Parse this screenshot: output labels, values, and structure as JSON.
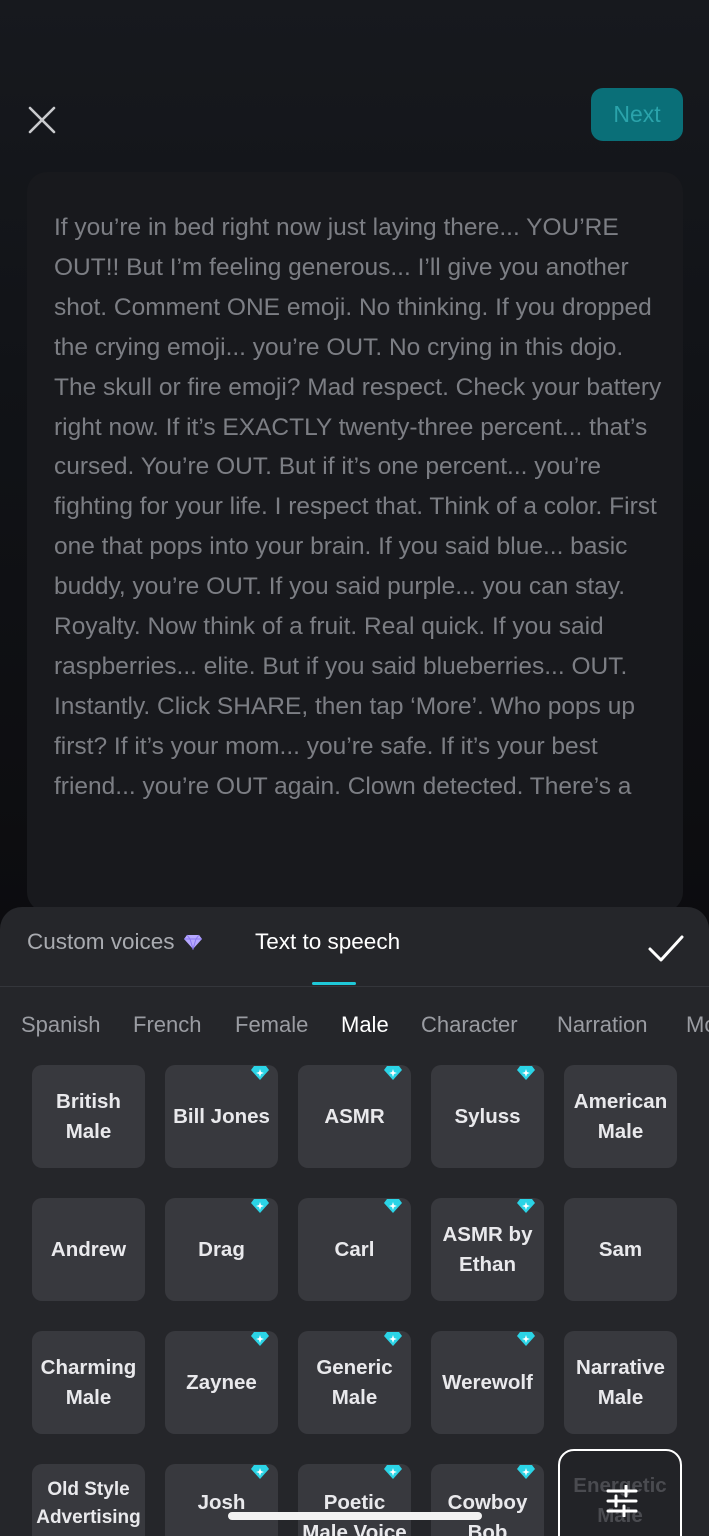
{
  "header": {
    "close_icon": "close-icon",
    "next_label": "Next"
  },
  "script": {
    "text": "If you’re in bed right now just laying there... YOU’RE OUT!! But I’m feeling generous... I’ll give you another shot. Comment ONE emoji. No thinking. If you dropped the crying emoji... you’re OUT. No crying in this dojo. The skull or fire emoji? Mad respect. Check your battery right now. If it’s EXACTLY twenty-three percent... that’s cursed. You’re OUT. But if it’s one percent... you’re fighting for your life. I respect that. Think of a color. First one that pops into your brain. If you said blue... basic buddy, you’re OUT. If you said purple... you can stay. Royalty. Now think of a fruit. Real quick. If you said raspberries... elite. But if you said blueberries... OUT. Instantly. Click SHARE, then tap ‘More’. Who pops up first? If it’s your mom... you’re safe. If it’s your best friend... you’re OUT again. Clown detected. There’s a"
  },
  "panel": {
    "tabs": [
      {
        "label": "Custom voices",
        "icon": "diamond-icon"
      },
      {
        "label": "Text to speech",
        "active": true
      }
    ],
    "confirm_icon": "checkmark-icon",
    "categories": [
      "Spanish",
      "French",
      "Female",
      "Male",
      "Character",
      "Narration",
      "Mo"
    ],
    "active_category": "Male",
    "voices": [
      {
        "name": "British Male",
        "premium": false
      },
      {
        "name": "Bill Jones",
        "premium": true
      },
      {
        "name": "ASMR",
        "premium": true
      },
      {
        "name": "Syluss",
        "premium": true
      },
      {
        "name": "American Male",
        "premium": false
      },
      {
        "name": "Andrew",
        "premium": false
      },
      {
        "name": "Drag",
        "premium": true
      },
      {
        "name": "Carl",
        "premium": true
      },
      {
        "name": "ASMR by Ethan",
        "premium": true
      },
      {
        "name": "Sam",
        "premium": false
      },
      {
        "name": "Charming Male",
        "premium": false
      },
      {
        "name": "Zaynee",
        "premium": true
      },
      {
        "name": "Generic Male",
        "premium": true
      },
      {
        "name": "Werewolf",
        "premium": true
      },
      {
        "name": "Narrative Male",
        "premium": false
      },
      {
        "name": "Old Style Advertising Male",
        "premium": false
      },
      {
        "name": "Josh",
        "premium": true
      },
      {
        "name": "Poetic Male Voice",
        "premium": true
      },
      {
        "name": "Cowboy Bob",
        "premium": true
      },
      {
        "name": "Energetic Male",
        "premium": false
      }
    ],
    "settings_icon": "sliders-icon",
    "accent_color": "#1fc8d8",
    "premium_color": "#2bd4e6"
  }
}
